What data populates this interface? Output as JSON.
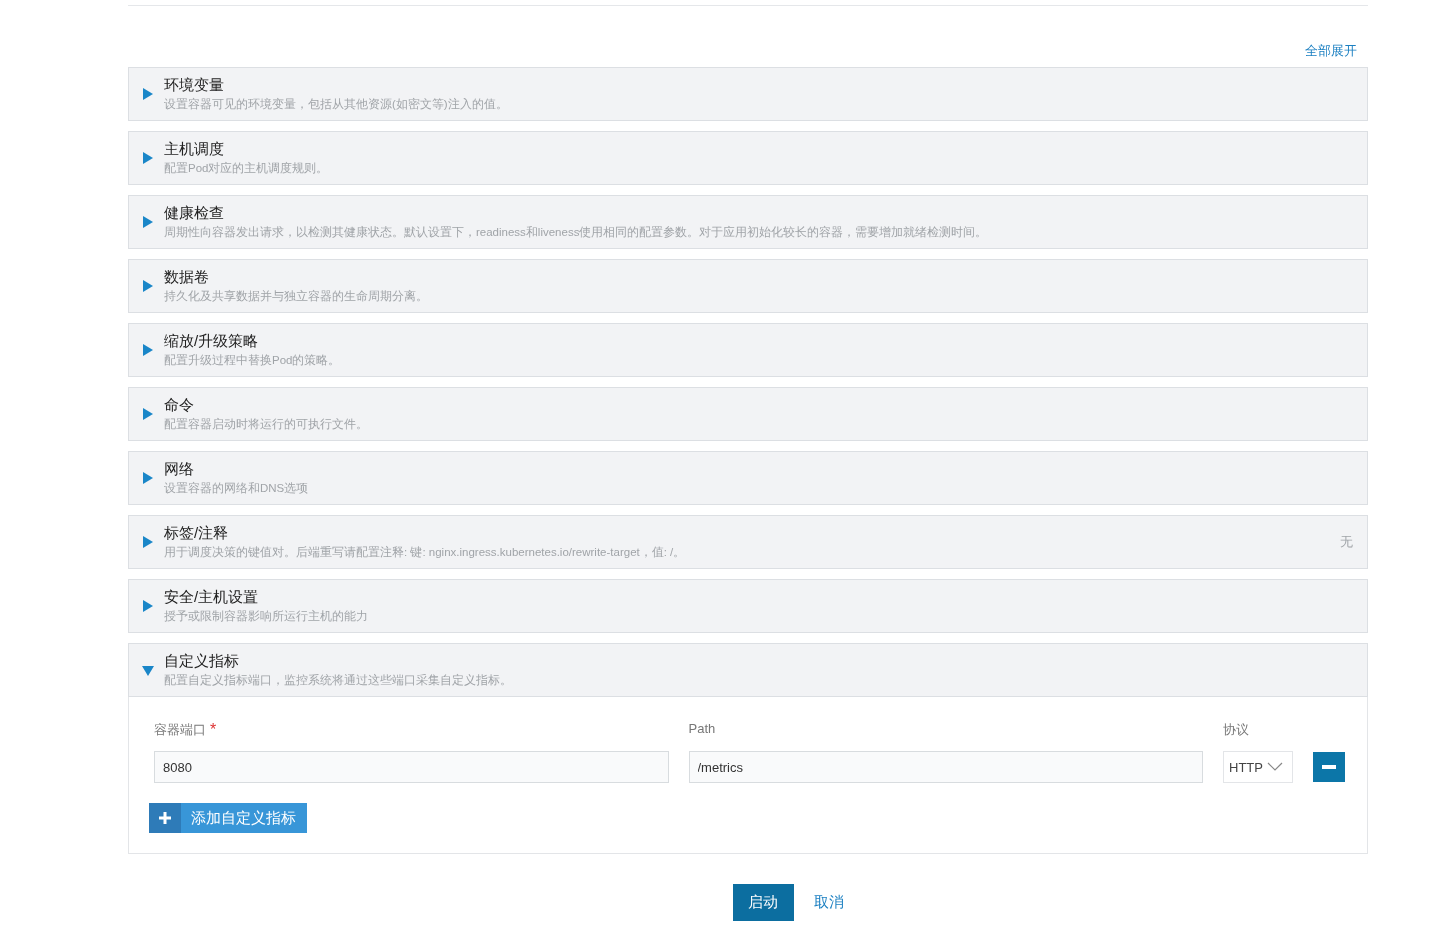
{
  "expand_all": "全部展开",
  "sections": [
    {
      "title": "环境变量",
      "description": "设置容器可见的环境变量，包括从其他资源(如密文等)注入的值。",
      "expanded": false
    },
    {
      "title": "主机调度",
      "description": "配置Pod对应的主机调度规则。",
      "expanded": false
    },
    {
      "title": "健康检查",
      "description": "周期性向容器发出请求，以检测其健康状态。默认设置下，readiness和liveness使用相同的配置参数。对于应用初始化较长的容器，需要增加就绪检测时间。",
      "expanded": false
    },
    {
      "title": "数据卷",
      "description": "持久化及共享数据并与独立容器的生命周期分离。",
      "expanded": false
    },
    {
      "title": "缩放/升级策略",
      "description": "配置升级过程中替换Pod的策略。",
      "expanded": false
    },
    {
      "title": "命令",
      "description": "配置容器启动时将运行的可执行文件。",
      "expanded": false
    },
    {
      "title": "网络",
      "description": "设置容器的网络和DNS选项",
      "expanded": false
    },
    {
      "title": "标签/注释",
      "description": "用于调度决策的键值对。后端重写请配置注释: 键: nginx.ingress.kubernetes.io/rewrite-target，值: /。",
      "expanded": false,
      "status": "无"
    },
    {
      "title": "安全/主机设置",
      "description": "授予或限制容器影响所运行主机的能力",
      "expanded": false
    },
    {
      "title": "自定义指标",
      "description": "配置自定义指标端口，监控系统将通过这些端口采集自定义指标。",
      "expanded": true,
      "labels": {
        "port": "容器端口",
        "required": "*",
        "path": "Path",
        "protocol": "协议"
      },
      "metrics": [
        {
          "port": "8080",
          "path": "/metrics",
          "protocol": "HTTP"
        }
      ],
      "add_button": "添加自定义指标"
    }
  ],
  "buttons": {
    "start": "启动",
    "cancel": "取消"
  }
}
